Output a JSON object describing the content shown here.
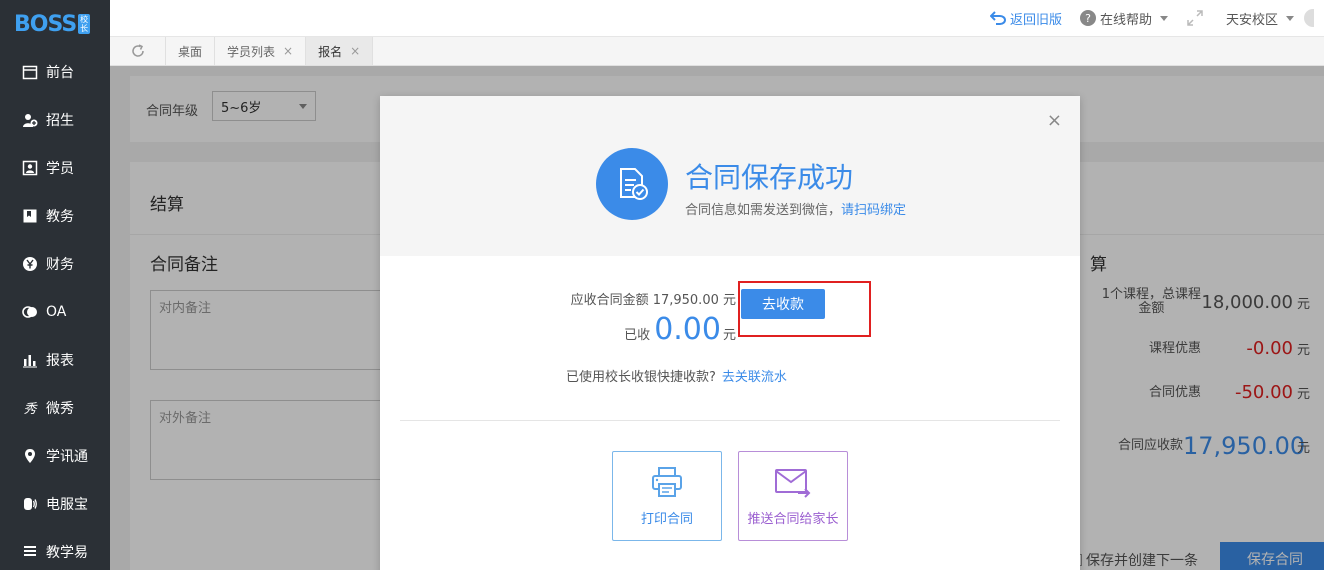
{
  "brand": {
    "logo_text": "BOSS",
    "logo_badge_top": "校",
    "logo_badge_bottom": "长"
  },
  "sidebar": {
    "items": [
      {
        "label": "前台",
        "icon": "calendar-icon"
      },
      {
        "label": "招生",
        "icon": "add-user-icon"
      },
      {
        "label": "学员",
        "icon": "student-card-icon"
      },
      {
        "label": "教务",
        "icon": "book-icon"
      },
      {
        "label": "财务",
        "icon": "yen-icon"
      },
      {
        "label": "OA",
        "icon": "oa-icon"
      },
      {
        "label": "报表",
        "icon": "bar-chart-icon"
      },
      {
        "label": "微秀",
        "icon": "weixiu-icon"
      },
      {
        "label": "学讯通",
        "icon": "location-pin-icon"
      },
      {
        "label": "电服宝",
        "icon": "phone-wave-icon"
      },
      {
        "label": "教学易",
        "icon": "list-icon"
      }
    ]
  },
  "topbar": {
    "back_old": "返回旧版",
    "help": "在线帮助",
    "campus": "天安校区"
  },
  "tabs": [
    {
      "label": "桌面",
      "closable": false
    },
    {
      "label": "学员列表",
      "closable": true
    },
    {
      "label": "报名",
      "closable": true,
      "active": true
    }
  ],
  "form": {
    "grade_label": "合同年级",
    "grade_value": "5~6岁",
    "settle_title": "结算",
    "remark_title": "合同备注",
    "inner_remark_placeholder": "对内备注",
    "outer_remark_placeholder": "对外备注",
    "summary_title_partial": "算",
    "summary": {
      "course_label_line1": "1个课程，总课程",
      "course_label_line2": "金额",
      "course_value": "18,000.00",
      "course_discount_label": "课程优惠",
      "course_discount_value": "-0.00",
      "contract_discount_label": "合同优惠",
      "contract_discount_value": "-50.00",
      "receivable_label": "合同应收款",
      "receivable_value": "17,950.00",
      "unit": "元"
    },
    "save_and_new_label": "保存并创建下一条",
    "save_button": "保存合同"
  },
  "modal": {
    "close_symbol": "×",
    "title": "合同保存成功",
    "subtitle": "合同信息如需发送到微信，",
    "subtitle_link": "请扫码绑定",
    "receivable_text": "应收合同金额 17,950.00 元",
    "go_pay_button": "去收款",
    "received_label": "已收",
    "received_value": "0.00",
    "received_unit": "元",
    "shortcut_text": "已使用校长收银快捷收款?",
    "shortcut_link": "去关联流水",
    "print_label": "打印合同",
    "push_label": "推送合同给家长"
  },
  "colors": {
    "accent": "#3b8be8",
    "sidebar_bg": "#2b3036",
    "danger": "#e02020",
    "purple": "#9b5fd0"
  }
}
